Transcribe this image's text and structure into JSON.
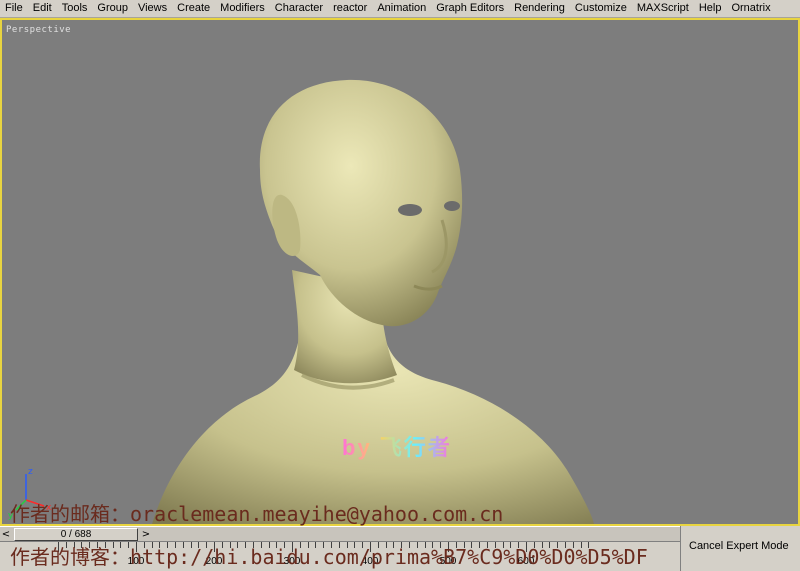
{
  "menu": [
    "File",
    "Edit",
    "Tools",
    "Group",
    "Views",
    "Create",
    "Modifiers",
    "Character",
    "reactor",
    "Animation",
    "Graph Editors",
    "Rendering",
    "Customize",
    "MAXScript",
    "Help",
    "Ornatrix"
  ],
  "viewport": {
    "label": "Perspective",
    "border_color": "#e8d440",
    "background": "#7d7d7d",
    "model_color": "#c9c490"
  },
  "axis_gizmo": {
    "x": "x",
    "y": "y",
    "z": "z"
  },
  "watermark": {
    "by_text": "by 飞行者",
    "email_line": "作者的邮箱：oraclemean.meayihe@yahoo.com.cn",
    "blog_line": "作者的博客：http://hi.baidu.com/prima%B7%C9%D0%D0%D5%DF"
  },
  "timeline": {
    "prev_label": "<",
    "next_label": ">",
    "frame_display": "0 / 688",
    "current_frame": 0,
    "total_frames": 688,
    "ruler_labels": [
      "100",
      "200",
      "300",
      "400",
      "500",
      "600"
    ]
  },
  "expert_mode": {
    "cancel_label": "Cancel Expert Mode"
  }
}
